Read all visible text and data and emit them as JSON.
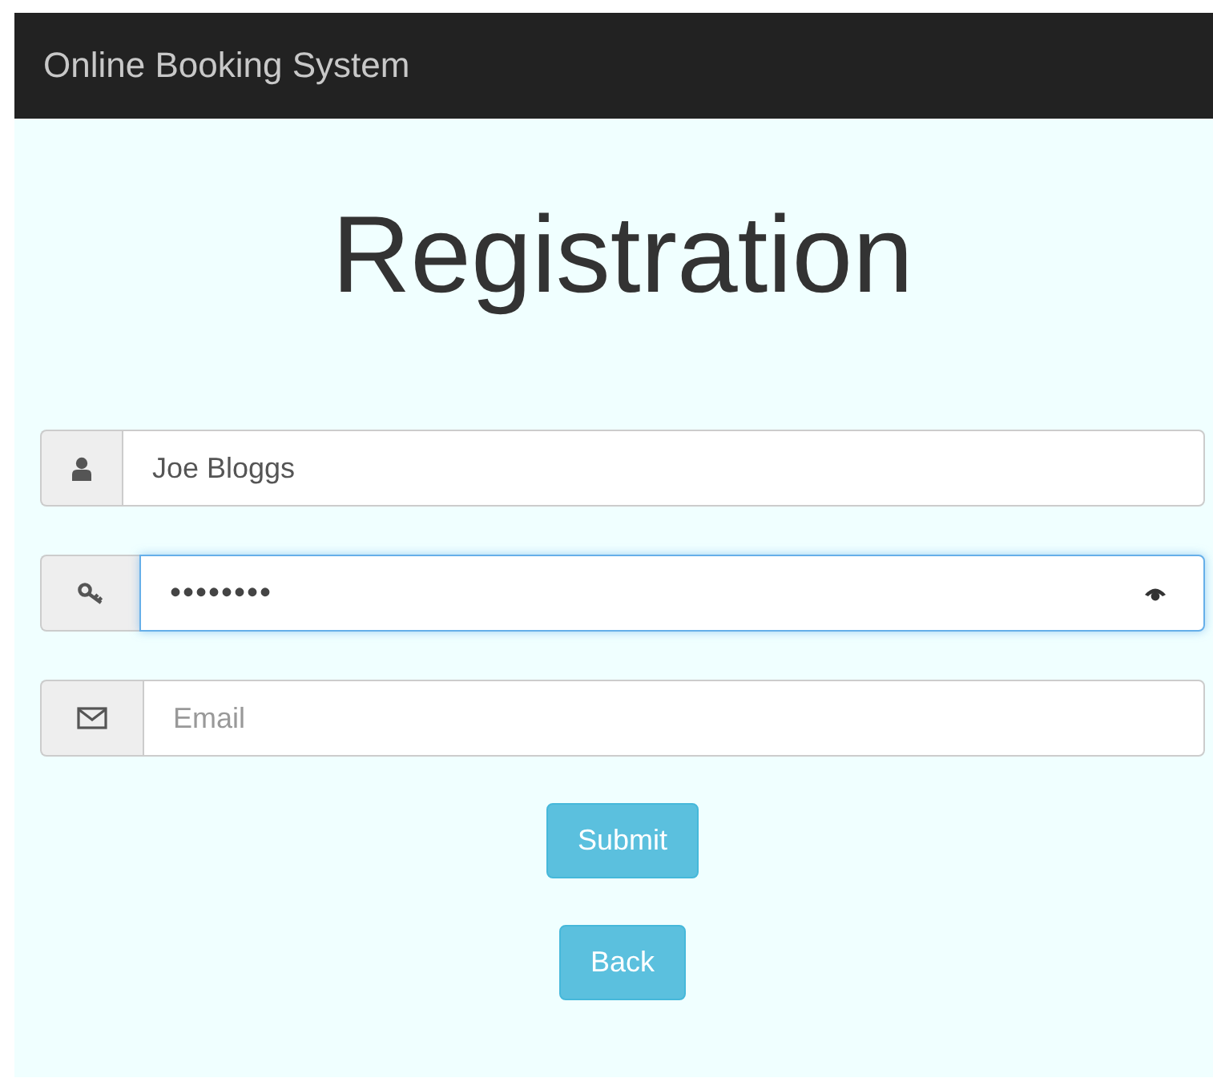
{
  "navbar": {
    "brand": "Online Booking System"
  },
  "title": "Registration",
  "fields": [
    {
      "kind": "name",
      "value": "Joe Bloggs",
      "focused": false
    },
    {
      "kind": "password",
      "value": "••••••••",
      "focused": true,
      "reveal_toggle": true
    },
    {
      "kind": "email",
      "placeholder": "Email",
      "focused": false
    }
  ],
  "buttons": [
    {
      "label": "Submit"
    },
    {
      "label": "Back"
    }
  ]
}
